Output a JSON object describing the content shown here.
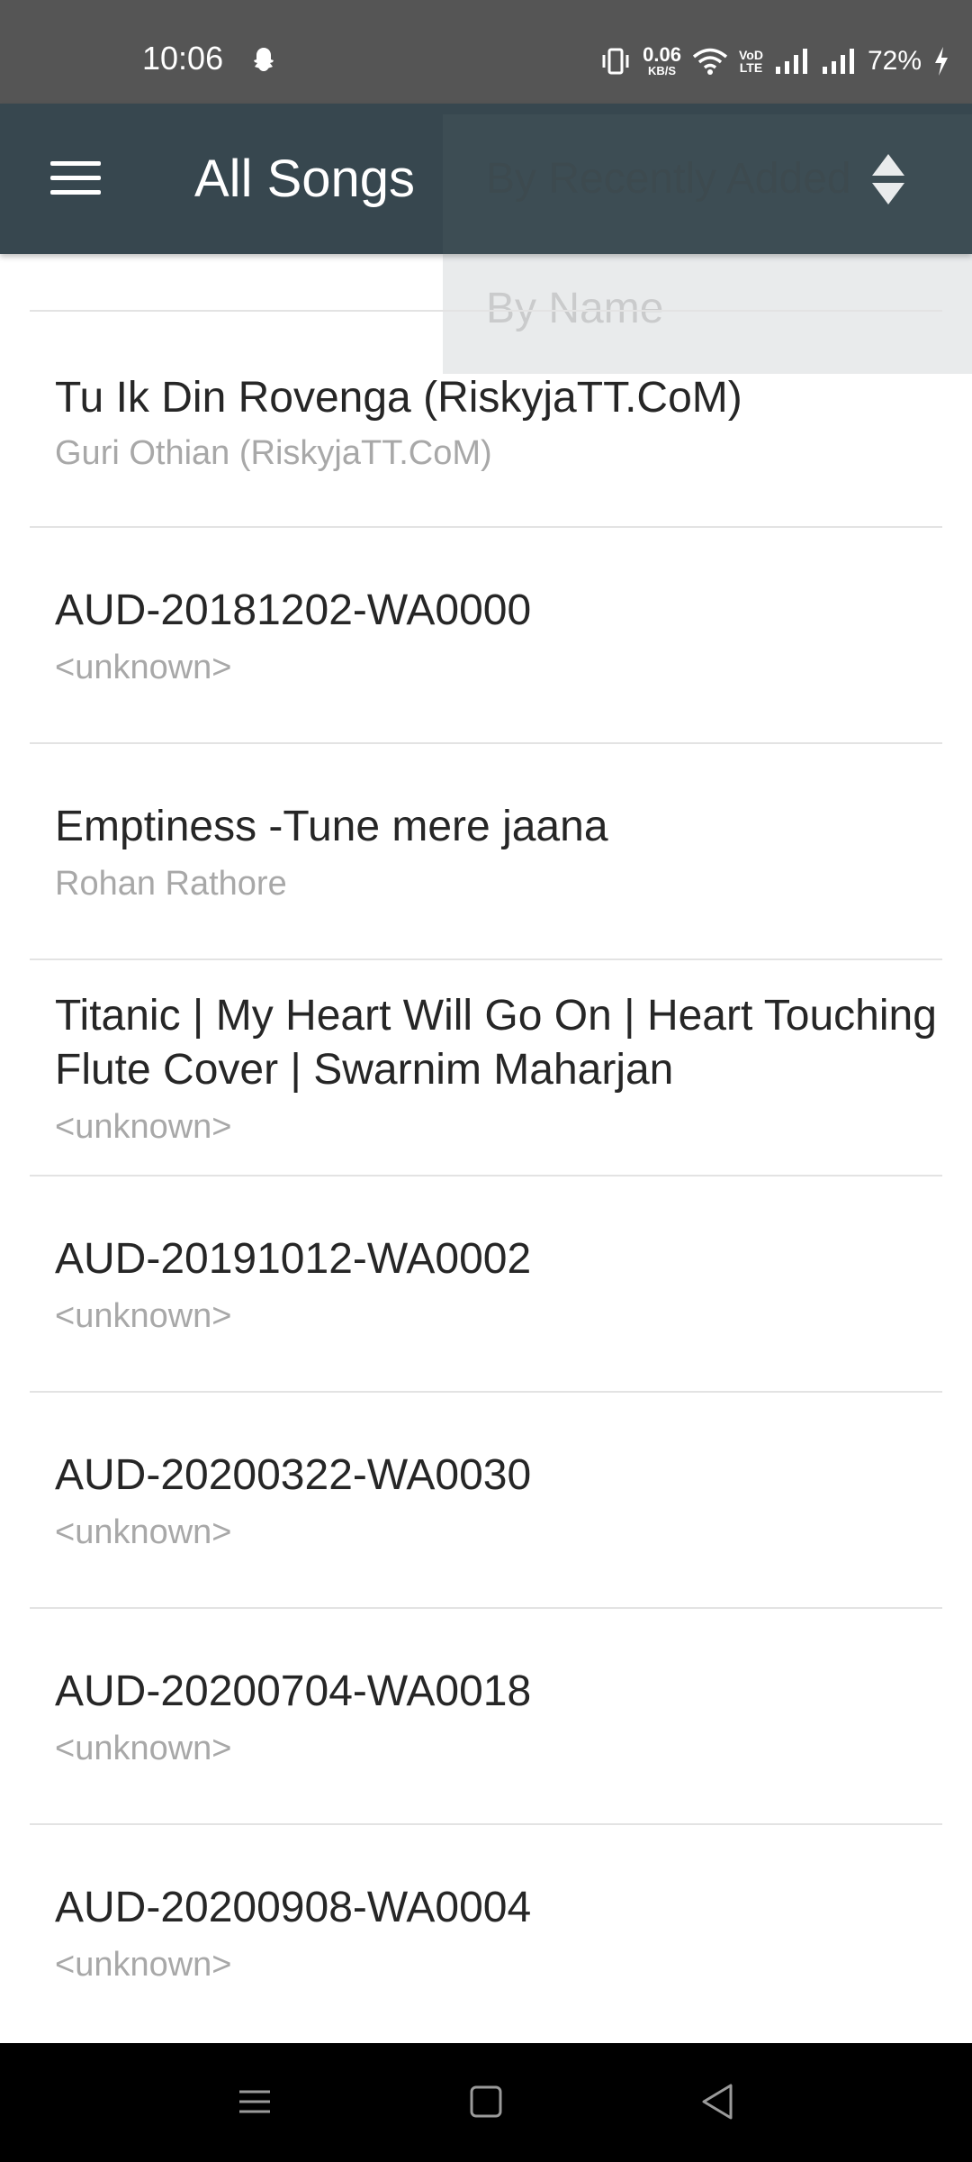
{
  "status_bar": {
    "time": "10:06",
    "net_speed_value": "0.06",
    "net_speed_unit": "KB/S",
    "volte_top": "VoD",
    "volte_bottom": "LTE",
    "battery": "72%",
    "icons": [
      "snapchat-icon",
      "vibrate-icon",
      "wifi-icon",
      "signal-icon",
      "signal-icon",
      "charging-icon"
    ]
  },
  "app_bar": {
    "title": "All Songs",
    "menu_icon": "hamburger-menu-icon",
    "sort_icon": "sort-updown-icon"
  },
  "sort_menu": {
    "options": [
      "By Recently Added",
      "By Name"
    ]
  },
  "songs": [
    {
      "title": "Tu Ik Din Rovenga (RiskyjaTT.CoM)",
      "artist": "Guri Othian (RiskyjaTT.CoM)"
    },
    {
      "title": "AUD-20181202-WA0000",
      "artist": "<unknown>"
    },
    {
      "title": "Emptiness -Tune mere jaana",
      "artist": "Rohan Rathore"
    },
    {
      "title": "Titanic | My Heart Will Go On | Heart Touching Flute Cover | Swarnim Maharjan",
      "artist": "<unknown>"
    },
    {
      "title": "AUD-20191012-WA0002",
      "artist": "<unknown>"
    },
    {
      "title": "AUD-20200322-WA0030",
      "artist": "<unknown>"
    },
    {
      "title": "AUD-20200704-WA0018",
      "artist": "<unknown>"
    },
    {
      "title": "AUD-20200908-WA0004",
      "artist": "<unknown>"
    }
  ],
  "nav_bar": {
    "icons": [
      "recent-apps-icon",
      "home-icon",
      "back-icon"
    ]
  }
}
